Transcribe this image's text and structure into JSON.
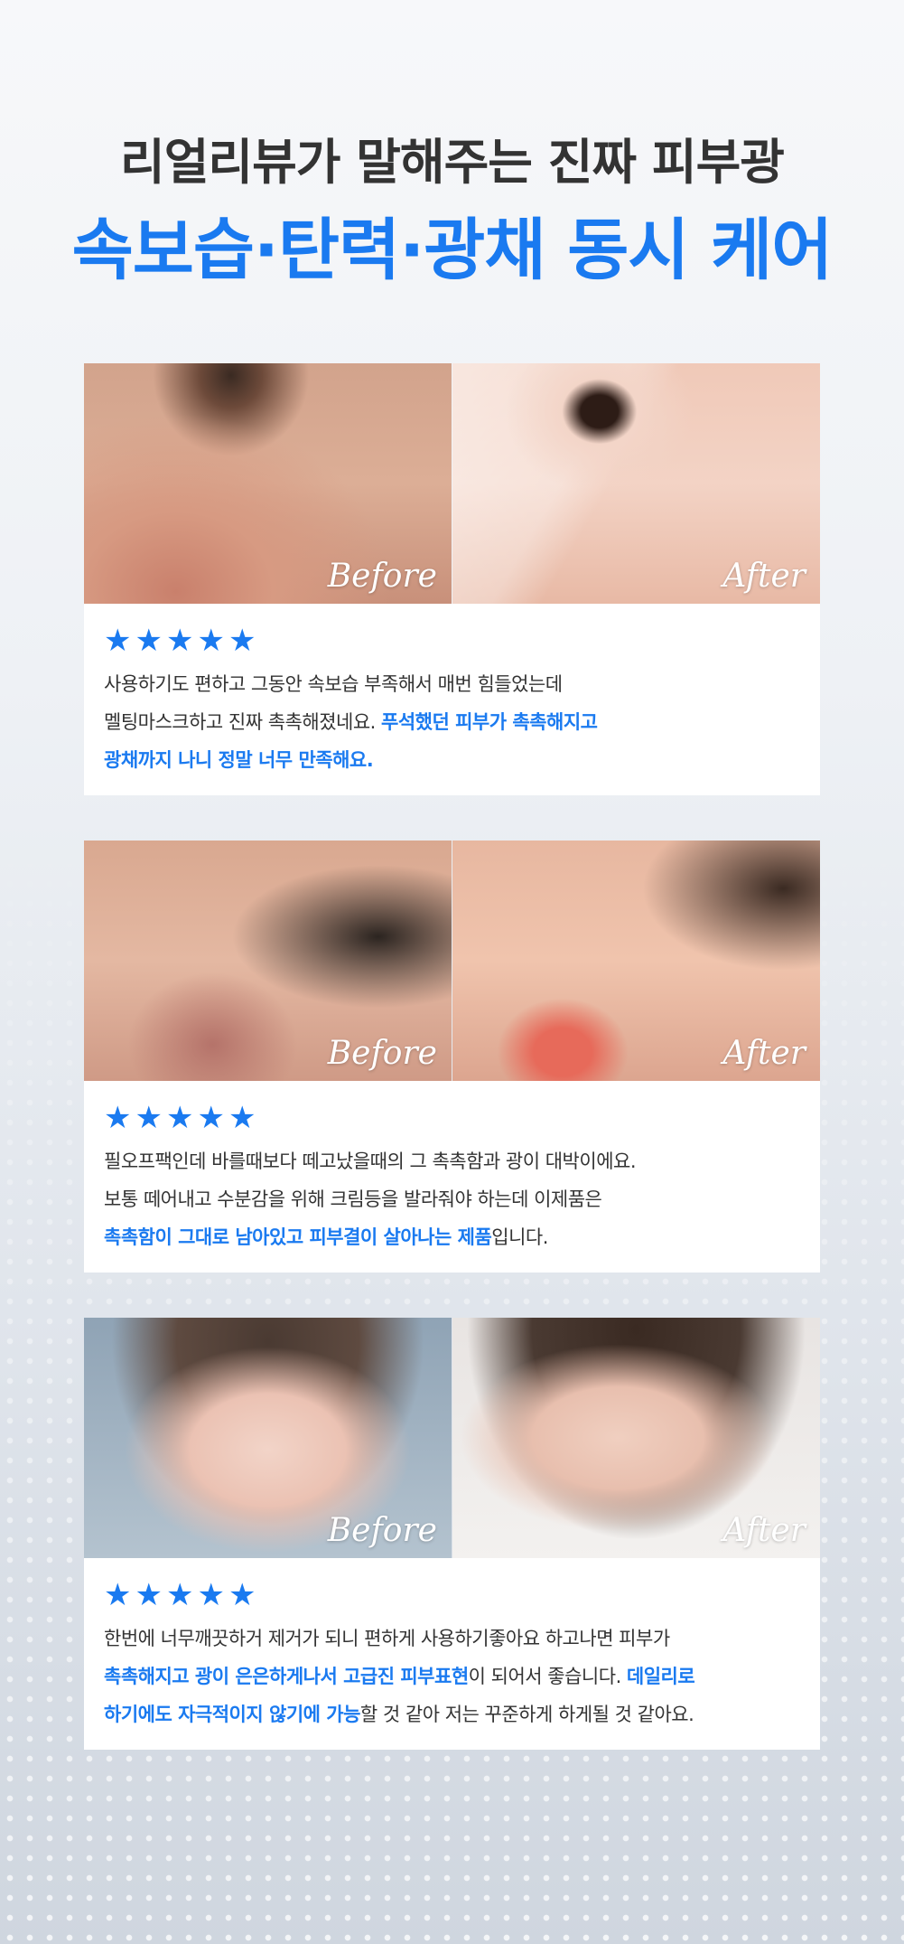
{
  "header": {
    "subtitle": "리얼리뷰가 말해주는 진짜 피부광",
    "title": "속보습·탄력·광채 동시 케어"
  },
  "photo_labels": {
    "before": "Before",
    "after": "After"
  },
  "star_glyph": "★",
  "accent_color": "#1a7af0",
  "reviews": [
    {
      "rating": 5,
      "lines": [
        {
          "t1": "사용하기도 편하고 그동안 속보습 부족해서 매번 힘들었는데"
        },
        {
          "t1": "멜팅마스크하고 진짜 촉촉해졌네요. ",
          "h1": "푸석했던 피부가 촉촉해지고"
        },
        {
          "h1": "광채까지 나니 정말 너무 만족해요."
        }
      ]
    },
    {
      "rating": 5,
      "lines": [
        {
          "t1": "필오프팩인데 바를때보다 떼고났을때의 그 촉촉함과 광이 대박이에요."
        },
        {
          "t1": "보통 떼어내고 수분감을 위해 크림등을 발라줘야 하는데 이제품은"
        },
        {
          "h1": "촉촉함이 그대로 남아있고 피부결이 살아나는 제품",
          "t2": "입니다."
        }
      ]
    },
    {
      "rating": 5,
      "lines": [
        {
          "t1": "한번에 너무깨끗하거 제거가 되니 편하게 사용하기좋아요 하고나면 피부가"
        },
        {
          "h1": "촉촉해지고 광이 은은하게나서 고급진 피부표현",
          "t2": "이 되어서 좋습니다. ",
          "h2": "데일리로"
        },
        {
          "h1": "하기에도 자극적이지 않기에 가능",
          "t2": "할 것 같아 저는 꾸준하게 하게될 것 같아요."
        }
      ]
    }
  ]
}
